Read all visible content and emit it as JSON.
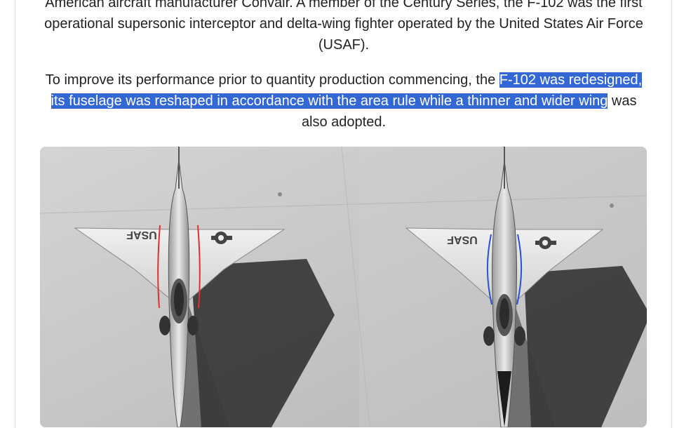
{
  "article": {
    "paragraph1": {
      "line1": "American aircraft manufacturer Convair. A member of the Century Series, the F-102 was the first",
      "line2": "operational supersonic interceptor and delta-wing fighter operated by the United States Air Force",
      "line3": "(USAF)."
    },
    "paragraph2": {
      "before": "To improve its performance prior to quantity production commencing, the ",
      "highlight1": "F-102 was redesigned,",
      "highlight2": "its fuselage was reshaped in accordance with the area rule while a thinner and wider wing",
      "after": " was",
      "last": "also adopted."
    },
    "figure": {
      "left_marking": "USAF",
      "right_marking": "USAF"
    }
  },
  "colors": {
    "selection": "#3367d6",
    "text": "#222222",
    "left_outline": "#e03030",
    "right_outline": "#2b4fd8"
  }
}
